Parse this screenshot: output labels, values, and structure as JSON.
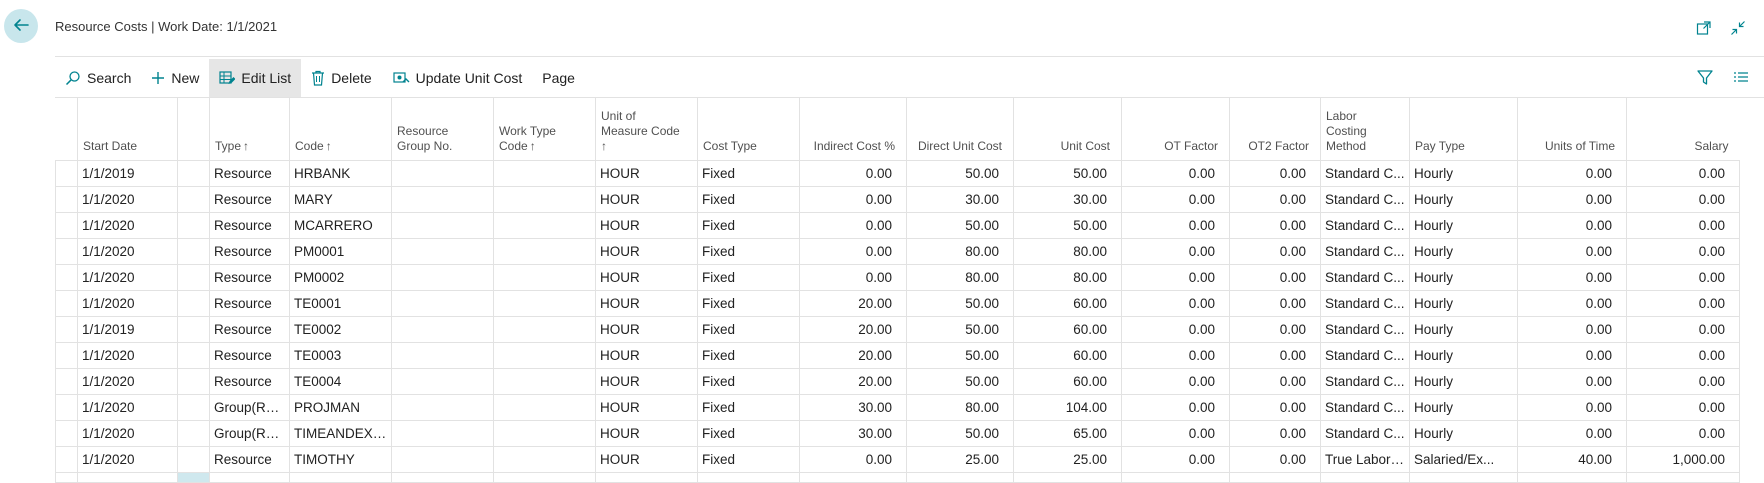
{
  "header": {
    "title": "Resource Costs | Work Date: 1/1/2021"
  },
  "toolbar": {
    "search_label": "Search",
    "new_label": "New",
    "edit_list_label": "Edit List",
    "delete_label": "Delete",
    "update_unit_cost_label": "Update Unit Cost",
    "page_label": "Page"
  },
  "icons": {
    "back": "arrow-left-icon",
    "open_new_window": "open-in-new-window-icon",
    "collapse": "collapse-icon",
    "filter": "filter-icon",
    "list_view": "list-view-icon"
  },
  "colors": {
    "accent": "#00838f",
    "back_button_bg": "#c8e6ec",
    "active_toolbar_bg": "#e6e6e6"
  },
  "columns": {
    "start_date": "Start Date",
    "type": "Type",
    "code": "Code",
    "resource_group_no_1": "Resource",
    "resource_group_no_2": "Group No.",
    "work_type_code_1": "Work Type",
    "work_type_code_2": "Code",
    "uom_1": "Unit of",
    "uom_2": "Measure Code",
    "cost_type": "Cost Type",
    "indirect_cost": "Indirect Cost %",
    "direct_unit_cost": "Direct Unit Cost",
    "unit_cost": "Unit Cost",
    "ot_factor": "OT Factor",
    "ot2_factor": "OT2 Factor",
    "labor_1": "Labor",
    "labor_2": "Costing",
    "labor_3": "Method",
    "pay_type": "Pay Type",
    "units_of_time": "Units of Time",
    "salary": "Salary",
    "sort_arrow": "↑"
  },
  "rows": [
    {
      "start_date": "1/1/2019",
      "type": "Resource",
      "code": "HRBANK",
      "group": "",
      "work_type": "",
      "uom": "HOUR",
      "cost_type": "Fixed",
      "indirect": "0.00",
      "direct": "50.00",
      "unit_cost": "50.00",
      "ot": "0.00",
      "ot2": "0.00",
      "labor": "Standard C...",
      "pay_type": "Hourly",
      "units_time": "0.00",
      "salary": "0.00"
    },
    {
      "start_date": "1/1/2020",
      "type": "Resource",
      "code": "MARY",
      "group": "",
      "work_type": "",
      "uom": "HOUR",
      "cost_type": "Fixed",
      "indirect": "0.00",
      "direct": "30.00",
      "unit_cost": "30.00",
      "ot": "0.00",
      "ot2": "0.00",
      "labor": "Standard C...",
      "pay_type": "Hourly",
      "units_time": "0.00",
      "salary": "0.00"
    },
    {
      "start_date": "1/1/2020",
      "type": "Resource",
      "code": "MCARRERO",
      "group": "",
      "work_type": "",
      "uom": "HOUR",
      "cost_type": "Fixed",
      "indirect": "0.00",
      "direct": "50.00",
      "unit_cost": "50.00",
      "ot": "0.00",
      "ot2": "0.00",
      "labor": "Standard C...",
      "pay_type": "Hourly",
      "units_time": "0.00",
      "salary": "0.00"
    },
    {
      "start_date": "1/1/2020",
      "type": "Resource",
      "code": "PM0001",
      "group": "",
      "work_type": "",
      "uom": "HOUR",
      "cost_type": "Fixed",
      "indirect": "0.00",
      "direct": "80.00",
      "unit_cost": "80.00",
      "ot": "0.00",
      "ot2": "0.00",
      "labor": "Standard C...",
      "pay_type": "Hourly",
      "units_time": "0.00",
      "salary": "0.00"
    },
    {
      "start_date": "1/1/2020",
      "type": "Resource",
      "code": "PM0002",
      "group": "",
      "work_type": "",
      "uom": "HOUR",
      "cost_type": "Fixed",
      "indirect": "0.00",
      "direct": "80.00",
      "unit_cost": "80.00",
      "ot": "0.00",
      "ot2": "0.00",
      "labor": "Standard C...",
      "pay_type": "Hourly",
      "units_time": "0.00",
      "salary": "0.00"
    },
    {
      "start_date": "1/1/2020",
      "type": "Resource",
      "code": "TE0001",
      "group": "",
      "work_type": "",
      "uom": "HOUR",
      "cost_type": "Fixed",
      "indirect": "20.00",
      "direct": "50.00",
      "unit_cost": "60.00",
      "ot": "0.00",
      "ot2": "0.00",
      "labor": "Standard C...",
      "pay_type": "Hourly",
      "units_time": "0.00",
      "salary": "0.00"
    },
    {
      "start_date": "1/1/2019",
      "type": "Resource",
      "code": "TE0002",
      "group": "",
      "work_type": "",
      "uom": "HOUR",
      "cost_type": "Fixed",
      "indirect": "20.00",
      "direct": "50.00",
      "unit_cost": "60.00",
      "ot": "0.00",
      "ot2": "0.00",
      "labor": "Standard C...",
      "pay_type": "Hourly",
      "units_time": "0.00",
      "salary": "0.00"
    },
    {
      "start_date": "1/1/2020",
      "type": "Resource",
      "code": "TE0003",
      "group": "",
      "work_type": "",
      "uom": "HOUR",
      "cost_type": "Fixed",
      "indirect": "20.00",
      "direct": "50.00",
      "unit_cost": "60.00",
      "ot": "0.00",
      "ot2": "0.00",
      "labor": "Standard C...",
      "pay_type": "Hourly",
      "units_time": "0.00",
      "salary": "0.00"
    },
    {
      "start_date": "1/1/2020",
      "type": "Resource",
      "code": "TE0004",
      "group": "",
      "work_type": "",
      "uom": "HOUR",
      "cost_type": "Fixed",
      "indirect": "20.00",
      "direct": "50.00",
      "unit_cost": "60.00",
      "ot": "0.00",
      "ot2": "0.00",
      "labor": "Standard C...",
      "pay_type": "Hourly",
      "units_time": "0.00",
      "salary": "0.00"
    },
    {
      "start_date": "1/1/2020",
      "type": "Group(Reso...",
      "code": "PROJMAN",
      "group": "",
      "work_type": "",
      "uom": "HOUR",
      "cost_type": "Fixed",
      "indirect": "30.00",
      "direct": "80.00",
      "unit_cost": "104.00",
      "ot": "0.00",
      "ot2": "0.00",
      "labor": "Standard C...",
      "pay_type": "Hourly",
      "units_time": "0.00",
      "salary": "0.00"
    },
    {
      "start_date": "1/1/2020",
      "type": "Group(Reso...",
      "code": "TIMEANDEXP...",
      "group": "",
      "work_type": "",
      "uom": "HOUR",
      "cost_type": "Fixed",
      "indirect": "30.00",
      "direct": "50.00",
      "unit_cost": "65.00",
      "ot": "0.00",
      "ot2": "0.00",
      "labor": "Standard C...",
      "pay_type": "Hourly",
      "units_time": "0.00",
      "salary": "0.00"
    },
    {
      "start_date": "1/1/2020",
      "type": "Resource",
      "code": "TIMOTHY",
      "group": "",
      "work_type": "",
      "uom": "HOUR",
      "cost_type": "Fixed",
      "indirect": "0.00",
      "direct": "25.00",
      "unit_cost": "25.00",
      "ot": "0.00",
      "ot2": "0.00",
      "labor": "True Labor ...",
      "pay_type": "Salaried/Ex...",
      "units_time": "40.00",
      "salary": "1,000.00"
    }
  ]
}
